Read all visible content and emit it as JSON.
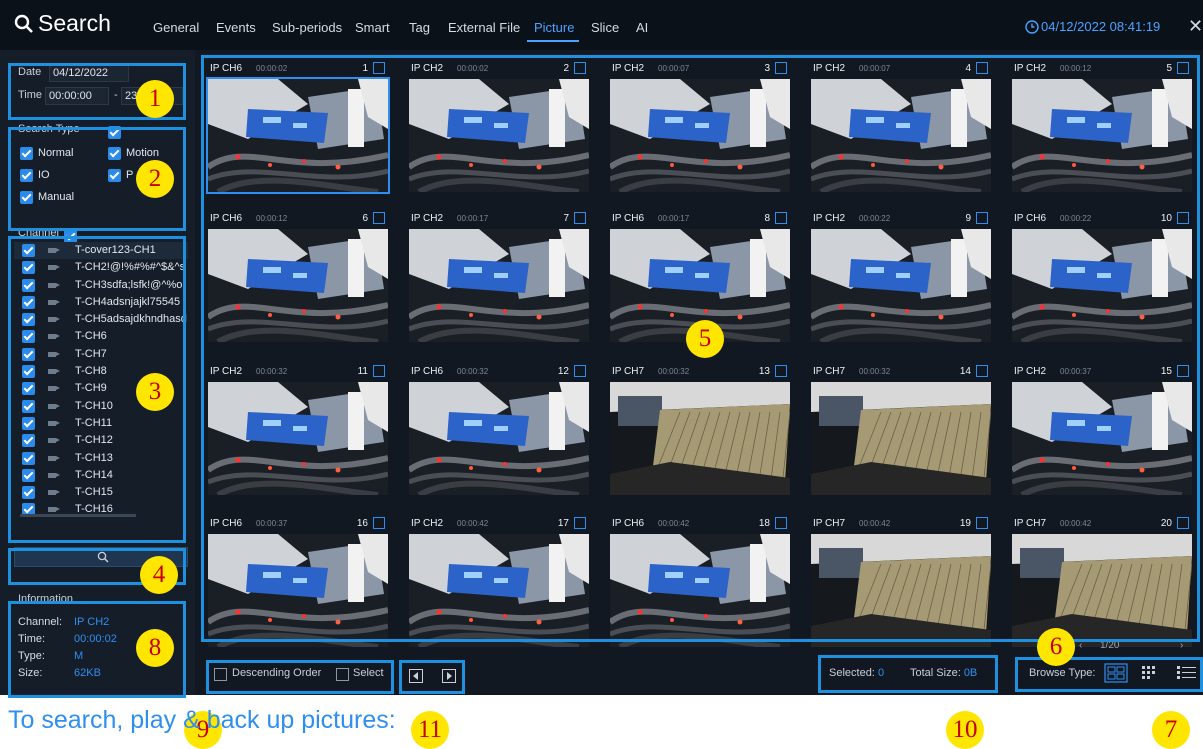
{
  "app": {
    "title": "Search",
    "tabs": [
      "General",
      "Events",
      "Sub-periods",
      "Smart",
      "Tag",
      "External File",
      "Picture",
      "Slice",
      "AI"
    ],
    "active_tab": "Picture",
    "datetime": "04/12/2022 08:41:19"
  },
  "sidebar": {
    "date_label": "Date",
    "date_value": "04/12/2022",
    "time_label": "Time",
    "time_start": "00:00:00",
    "time_sep": "-",
    "time_end": "23",
    "search_type_label": "Search Type",
    "search_types": [
      {
        "label": "Normal",
        "checked": true
      },
      {
        "label": "Motion",
        "checked": true
      },
      {
        "label": "IO",
        "checked": true
      },
      {
        "label": "P",
        "checked": true
      },
      {
        "label": "Manual",
        "checked": true
      }
    ],
    "channel_label": "Channel",
    "channels": [
      "T-cover123-CH1",
      "T-CH2!@!%#%#^$&^s",
      "T-CH3sdfa;lsfk!@^%o",
      "T-CH4adsnjajkl75545",
      "T-CH5adsajdkhndhasd",
      "T-CH6",
      "T-CH7",
      "T-CH8",
      "T-CH9",
      "T-CH10",
      "T-CH11",
      "T-CH12",
      "T-CH13",
      "T-CH14",
      "T-CH15",
      "T-CH16"
    ]
  },
  "information": {
    "title": "Information",
    "channel_key": "Channel:",
    "channel_value": "IP CH2",
    "time_key": "Time:",
    "time_value": "00:00:02",
    "type_key": "Type:",
    "type_value": "M",
    "size_key": "Size:",
    "size_value": "62KB"
  },
  "grid": {
    "pictures": [
      {
        "channel": "IP CH6",
        "time": "00:00:02",
        "index": "1",
        "scene": "cables",
        "selected": true
      },
      {
        "channel": "IP CH2",
        "time": "00:00:02",
        "index": "2",
        "scene": "cables",
        "selected": false
      },
      {
        "channel": "IP CH2",
        "time": "00:00:07",
        "index": "3",
        "scene": "cables",
        "selected": false
      },
      {
        "channel": "IP CH2",
        "time": "00:00:07",
        "index": "4",
        "scene": "cables",
        "selected": false
      },
      {
        "channel": "IP CH2",
        "time": "00:00:12",
        "index": "5",
        "scene": "cables",
        "selected": false
      },
      {
        "channel": "IP CH6",
        "time": "00:00:12",
        "index": "6",
        "scene": "cables",
        "selected": false
      },
      {
        "channel": "IP CH2",
        "time": "00:00:17",
        "index": "7",
        "scene": "cables",
        "selected": false
      },
      {
        "channel": "IP CH6",
        "time": "00:00:17",
        "index": "8",
        "scene": "cables",
        "selected": false
      },
      {
        "channel": "IP CH2",
        "time": "00:00:22",
        "index": "9",
        "scene": "cables",
        "selected": false
      },
      {
        "channel": "IP CH6",
        "time": "00:00:22",
        "index": "10",
        "scene": "cables",
        "selected": false
      },
      {
        "channel": "IP CH2",
        "time": "00:00:32",
        "index": "11",
        "scene": "cables",
        "selected": false
      },
      {
        "channel": "IP CH6",
        "time": "00:00:32",
        "index": "12",
        "scene": "cables",
        "selected": false
      },
      {
        "channel": "IP CH7",
        "time": "00:00:32",
        "index": "13",
        "scene": "mesh",
        "selected": false
      },
      {
        "channel": "IP CH7",
        "time": "00:00:32",
        "index": "14",
        "scene": "mesh",
        "selected": false
      },
      {
        "channel": "IP CH2",
        "time": "00:00:37",
        "index": "15",
        "scene": "cables",
        "selected": false
      },
      {
        "channel": "IP CH6",
        "time": "00:00:37",
        "index": "16",
        "scene": "cables",
        "selected": false
      },
      {
        "channel": "IP CH2",
        "time": "00:00:42",
        "index": "17",
        "scene": "cables",
        "selected": false
      },
      {
        "channel": "IP CH6",
        "time": "00:00:42",
        "index": "18",
        "scene": "cables",
        "selected": false
      },
      {
        "channel": "IP CH7",
        "time": "00:00:42",
        "index": "19",
        "scene": "mesh",
        "selected": false
      },
      {
        "channel": "IP CH7",
        "time": "00:00:42",
        "index": "20",
        "scene": "mesh",
        "selected": false
      }
    ]
  },
  "toolbar": {
    "descending_label": "Descending Order",
    "select_label": "Select",
    "selected_label": "Selected:",
    "selected_value": "0",
    "total_size_label": "Total Size:",
    "total_size_value": "0B",
    "browse_type_label": "Browse Type:",
    "page_indicator": "1/20"
  },
  "annotations": [
    "1",
    "2",
    "3",
    "4",
    "5",
    "6",
    "7",
    "8",
    "9",
    "10",
    "11"
  ],
  "caption": "To search, play & back up pictures:",
  "colors": {
    "accent": "#2f8ff0",
    "badge": "#ffe600",
    "badge_text": "#c80000",
    "frame": "#1e90e0"
  }
}
